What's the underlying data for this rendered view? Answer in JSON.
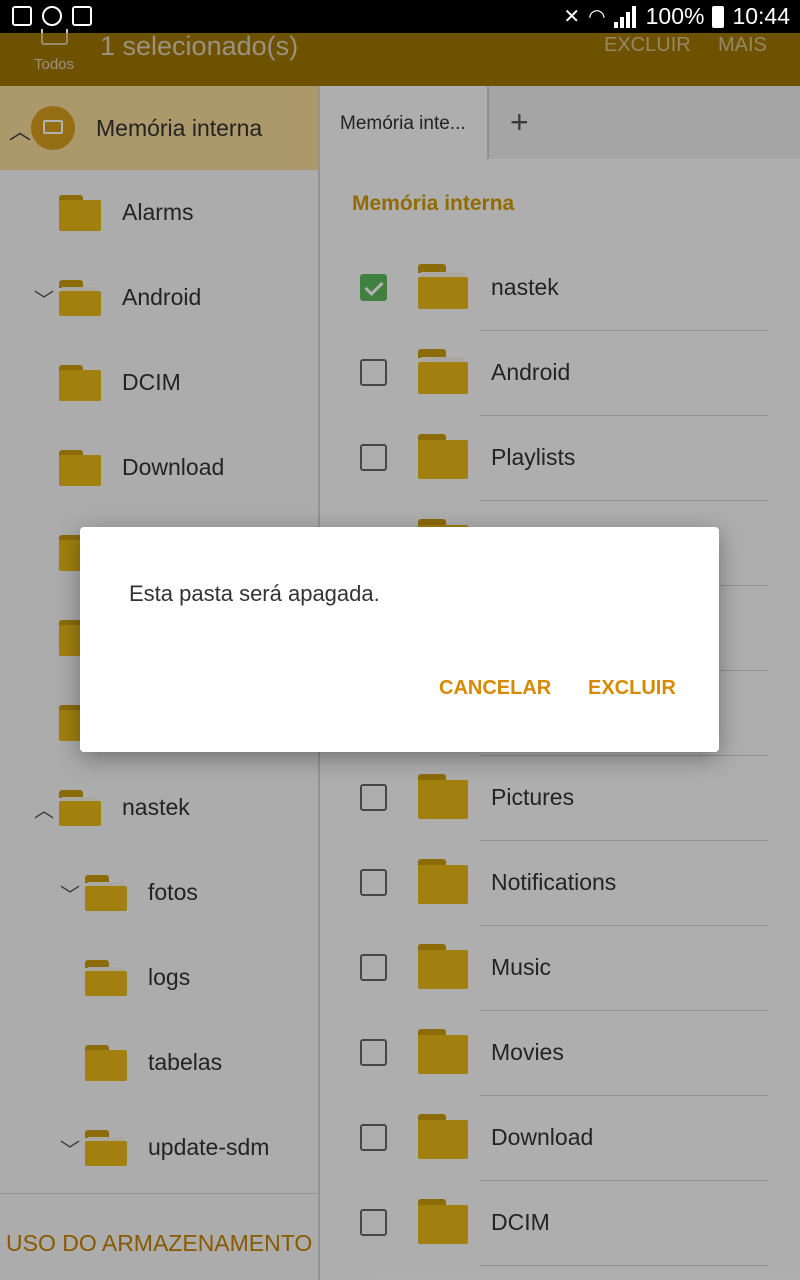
{
  "status_bar": {
    "battery": "100%",
    "time": "10:44",
    "left_icons": [
      "image-icon",
      "sync-icon",
      "sd-card-icon"
    ],
    "right_icons": [
      "mute-icon",
      "wifi-icon",
      "signal-icon",
      "battery-icon"
    ]
  },
  "action_bar": {
    "select_all_label": "Todos",
    "title": "1 selecionado(s)",
    "delete_label": "EXCLUIR",
    "more_label": "MAIS"
  },
  "left_panel": {
    "root_label": "Memória interna",
    "tree": [
      {
        "label": "Alarms"
      },
      {
        "label": "Android"
      },
      {
        "label": "DCIM"
      },
      {
        "label": "Download"
      },
      {
        "label": ""
      },
      {
        "label": ""
      },
      {
        "label": ""
      },
      {
        "label": "nastek"
      },
      {
        "label": "fotos"
      },
      {
        "label": "logs"
      },
      {
        "label": "tabelas"
      },
      {
        "label": "update-sdm"
      }
    ],
    "storage_usage_label": "USO DO ARMAZENAMENTO"
  },
  "right_panel": {
    "tab_label": "Memória inte...",
    "add_tab_label": "+",
    "section_title": "Memória interna",
    "items": [
      {
        "label": "nastek",
        "checked": true
      },
      {
        "label": "Android",
        "checked": false
      },
      {
        "label": "Playlists",
        "checked": false
      },
      {
        "label": "",
        "checked": false
      },
      {
        "label": "",
        "checked": false
      },
      {
        "label": "",
        "checked": false
      },
      {
        "label": "Pictures",
        "checked": false
      },
      {
        "label": "Notifications",
        "checked": false
      },
      {
        "label": "Music",
        "checked": false
      },
      {
        "label": "Movies",
        "checked": false
      },
      {
        "label": "Download",
        "checked": false
      },
      {
        "label": "DCIM",
        "checked": false
      }
    ]
  },
  "dialog": {
    "message": "Esta pasta será apagada.",
    "cancel_label": "CANCELAR",
    "confirm_label": "EXCLUIR"
  },
  "colors": {
    "action_bar": "#a07600",
    "accent": "#d68a00",
    "folder": "#e7b816",
    "checkbox_checked": "#5cb85c",
    "root_highlight": "#f5da9a"
  }
}
